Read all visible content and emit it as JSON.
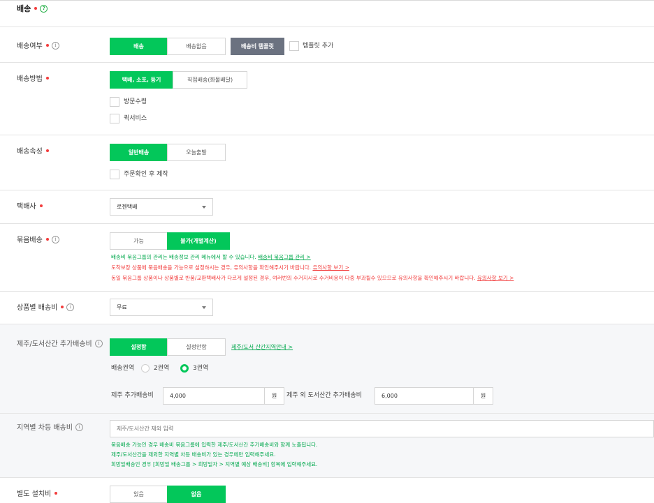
{
  "section": {
    "title": "배송"
  },
  "delivery_yn": {
    "label": "배송여부",
    "options": [
      "배송",
      "배송없음"
    ],
    "template_button": "배송비 템플릿",
    "template_add": "템플릿 추가"
  },
  "method": {
    "label": "배송방법",
    "options": [
      "택배, 소포, 등기",
      "직접배송(화물배달)"
    ],
    "checks": [
      "방문수령",
      "퀵서비스"
    ]
  },
  "attribute": {
    "label": "배송속성",
    "options": [
      "일반배송",
      "오늘출발"
    ],
    "check": "주문확인 후 제작"
  },
  "courier": {
    "label": "택배사",
    "value": "로젠택배"
  },
  "bundle": {
    "label": "묶음배송",
    "options": [
      "가능",
      "불가(개별계산)"
    ],
    "notice1": "배송비 묶음그룹의 관리는 배송정보 관리 메뉴에서 할 수 있습니다.",
    "notice1_link": "배송비 묶음그룹 관리 >",
    "notice2": "도착보장 상품에 묶음배송을 가능으로 설정하시는 경우, 유의사항을 확인해주시기 바랍니다.",
    "notice2_link": "유의사항 보기 >",
    "notice3": "동일 묶음그룹 상품이나 상품별로 반품/교환택배사가 다르게 설정된 경우, 여러번의 수거지시로 수거비용이 다중 부과될수 있으므로 유의사항을 확인해주시기 바랍니다.",
    "notice3_link": "유의사항 보기 >"
  },
  "product_fee": {
    "label": "상품별 배송비",
    "value": "무료"
  },
  "jeju": {
    "label": "제주/도서산간 추가배송비",
    "options": [
      "설정함",
      "설정안함"
    ],
    "guide_link": "제주/도서 산간지역안내 >",
    "zone_label": "배송권역",
    "zones": [
      "2권역",
      "3권역"
    ],
    "jeju_fee_label": "제주 추가배송비",
    "jeju_fee_value": "4,000",
    "unit": "원",
    "other_fee_label": "제주 외 도서산간 추가배송비",
    "other_fee_value": "6,000"
  },
  "region": {
    "label": "지역별 차등 배송비",
    "placeholder": "제주/도서산간 제외 입력",
    "notice1": "묶음배송 가능인 경우 배송비 묶음그룹에 입력한 제주/도서산간 추가배송비와 함께 노출됩니다.",
    "notice2": "제주/도서산간을 제외한 지역별 차등 배송비가 있는 경우에만 입력해주세요.",
    "notice3": "희망일배송인 경우 [희망일 배송그룹 > 희망일자 > 지역별 예상 배송비] 항목에 입력해주세요."
  },
  "install": {
    "label": "별도 설치비",
    "options": [
      "있음",
      "없음"
    ]
  },
  "colors": {
    "accent": "#03c75a",
    "required": "#f23c3c",
    "notice_green": "#03a84e",
    "template_gray": "#6b7280"
  }
}
